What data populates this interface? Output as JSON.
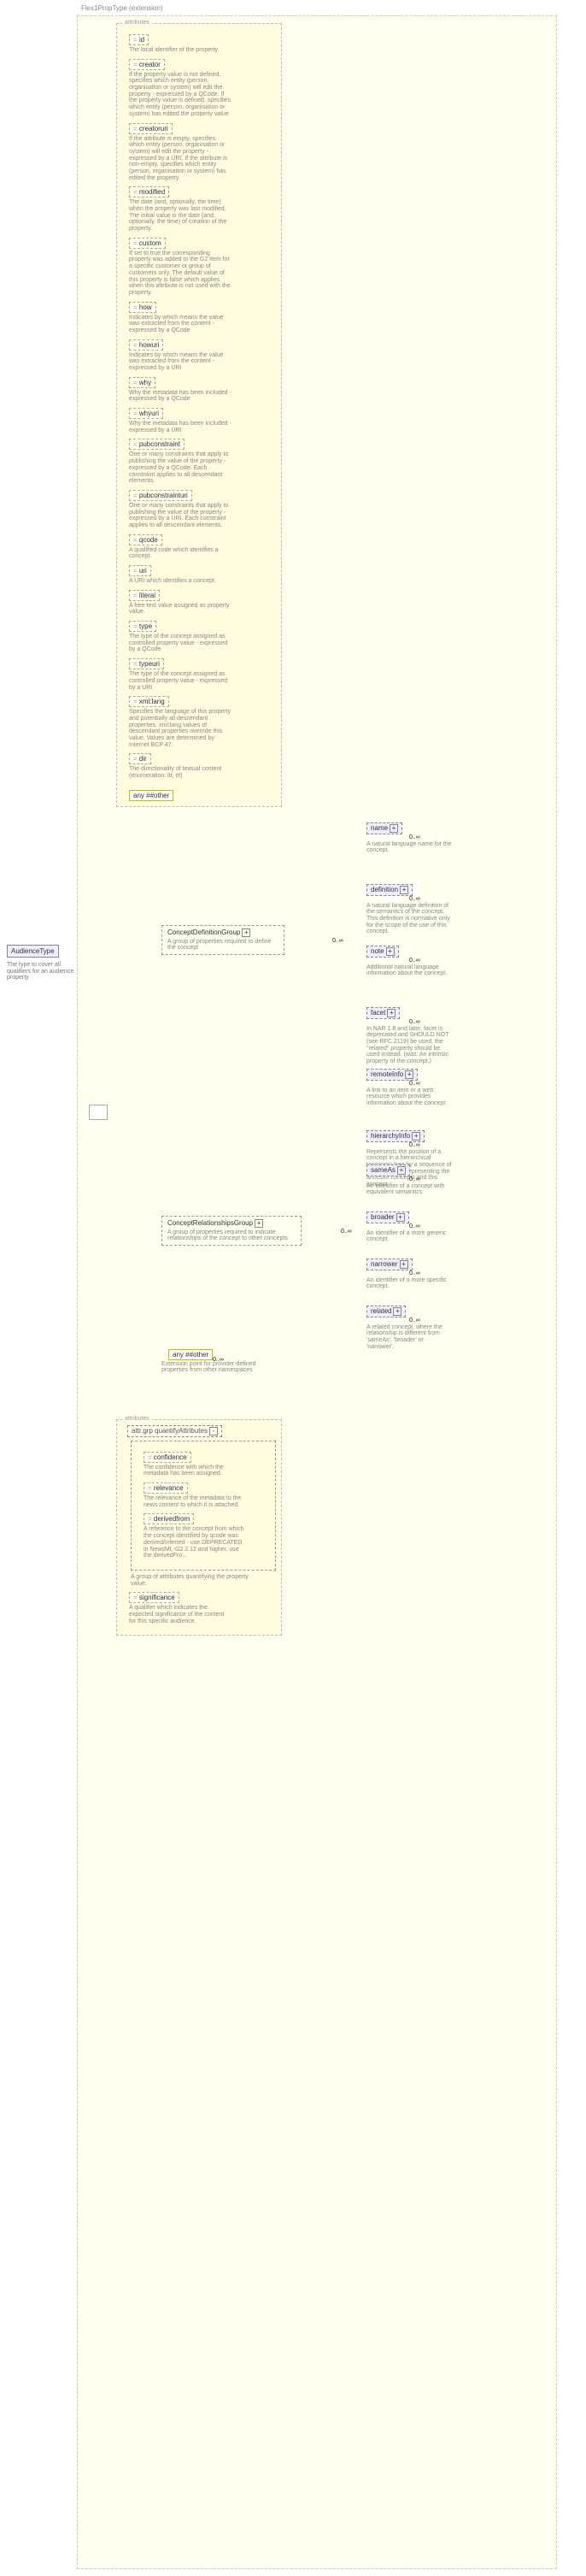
{
  "root": {
    "name": "AudienceType",
    "desc": "The type to cover all qualifiers for an audience property"
  },
  "extension": {
    "label": "Flex1PropType (extension)"
  },
  "attrs_header": "attributes",
  "any_label": "any ##other",
  "attributes1": [
    {
      "name": "id",
      "desc": "The local identifier of the property."
    },
    {
      "name": "creator",
      "desc": "If the property value is not defined, specifies which entity (person, organisation or system) will edit the property - expressed by a QCode. If the property value is defined, specifies which entity (person, organisation or system) has edited the property value."
    },
    {
      "name": "creatoruri",
      "desc": "If the attribute is empty, specifies which entity (person, organisation or system) will edit the property - expressed by a URI. If the attribute is non-empty, specifies which entity (person, organisation or system) has edited the property."
    },
    {
      "name": "modified",
      "desc": "The date (and, optionally, the time) when the property was last modified. The initial value is the date (and, optionally, the time) of creation of the property."
    },
    {
      "name": "custom",
      "desc": "If set to true the corresponding property was added to the G2 Item for a specific customer or group of customers only. The default value of this property is false which applies when this attribute is not used with the property."
    },
    {
      "name": "how",
      "desc": "Indicates by which means the value was extracted from the content - expressed by a QCode"
    },
    {
      "name": "howuri",
      "desc": "Indicates by which means the value was extracted from the content - expressed by a URI"
    },
    {
      "name": "why",
      "desc": "Why the metadata has been included - expressed by a QCode"
    },
    {
      "name": "whyuri",
      "desc": "Why the metadata has been included - expressed by a URI"
    },
    {
      "name": "pubconstraint",
      "desc": "One or many constraints that apply to publishing the value of the property - expressed by a QCode. Each constraint applies to all descendant elements."
    },
    {
      "name": "pubconstrainturi",
      "desc": "One or many constraints that apply to publishing the value of the property - expressed by a URI. Each constraint applies to all descendant elements."
    },
    {
      "name": "qcode",
      "desc": "A qualified code which identifies a concept."
    },
    {
      "name": "uri",
      "desc": "A URI which identifies a concept."
    },
    {
      "name": "literal",
      "desc": "A free-text value assigned as property value."
    },
    {
      "name": "type",
      "desc": "The type of the concept assigned as controlled property value - expressed by a QCode"
    },
    {
      "name": "typeuri",
      "desc": "The type of the concept assigned as controlled property value - expressed by a URI"
    },
    {
      "name": "xml:lang",
      "desc": "Specifies the language of this property and potentially all descendant properties. xml:lang values of descendant properties override this value. Values are determined by Internet BCP 47."
    },
    {
      "name": "dir",
      "desc": "The directionality of textual content (enumeration: ltr, rtl)"
    }
  ],
  "mid": {
    "cdg": {
      "name": "ConceptDefinitionGroup",
      "desc": "A group of properties required to define the concept"
    },
    "cdg_children": [
      {
        "name": "name",
        "desc": "A natural language name for the concept."
      },
      {
        "name": "definition",
        "desc": "A natural language definition of the semantics of the concept. This definition is normative only for the scope of the use of this concept."
      },
      {
        "name": "note",
        "desc": "Additional natural language information about the concept."
      },
      {
        "name": "facet",
        "desc": "In NAR 1.8 and later, facet is deprecated and SHOULD NOT (see RFC 2119) be used, the \"related\" property should be used instead. (was: An intrinsic property of the concept.)"
      },
      {
        "name": "remoteInfo",
        "desc": "A link to an item or a web resource which provides information about the concept"
      },
      {
        "name": "hierarchyInfo",
        "desc": "Represents the position of a concept in a hierarchical taxonomy tree by a sequence of QCode tokens representing the ancestor concepts and this concept"
      }
    ],
    "crg": {
      "name": "ConceptRelationshipsGroup",
      "desc": "A group of properties required to indicate relationships of the concept to other concepts"
    },
    "crg_children": [
      {
        "name": "sameAs",
        "desc": "An identifier of a concept with equivalent semantics"
      },
      {
        "name": "broader",
        "desc": "An identifier of a more generic concept."
      },
      {
        "name": "narrower",
        "desc": "An identifier of a more specific concept."
      },
      {
        "name": "related",
        "desc": "A related concept, where the relationship is different from 'sameAs', 'broader' or 'narrower'."
      }
    ],
    "any": {
      "label": "any ##other",
      "desc": "Extension point for provider-defined properties from other namespaces",
      "card": "0..∞"
    }
  },
  "attrgrp": {
    "header": "attributes",
    "grp_label": "attr.grp quantifyAttributes",
    "items": [
      {
        "name": "confidence",
        "desc": "The confidence with which the metadata has been assigned."
      },
      {
        "name": "relevance",
        "desc": "The relevance of the metadata to the news content to which it is attached."
      },
      {
        "name": "derivedfrom",
        "desc": "A reference to the concept from which the concept identified by qcode was derived/inferred - use DEPRECATED in NewsML-G2 2.12 and higher, use the derivedFro..."
      }
    ],
    "grp_desc": "A group of attributes quantifying the property value.",
    "significance": {
      "name": "significance",
      "desc": "A qualifier which indicates the expected significance of the content for this specific audience."
    }
  },
  "card_inf": "0..∞"
}
